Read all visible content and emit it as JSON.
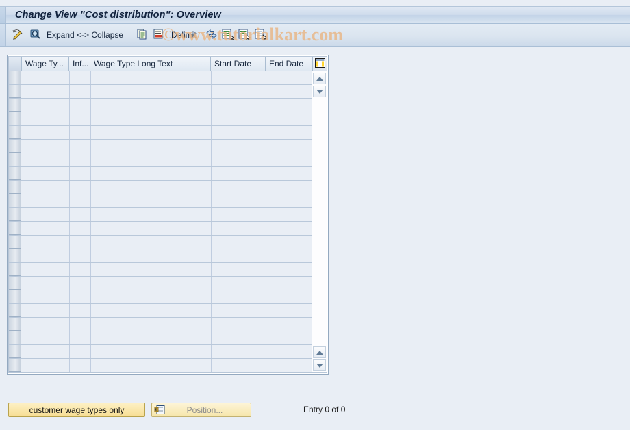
{
  "window": {
    "title": "Change View \"Cost distribution\": Overview"
  },
  "watermark": {
    "text": "©www.tutorialkart.com",
    "color": "#e8b98c"
  },
  "toolbar": {
    "items": [
      {
        "name": "display-change-icon",
        "icon": "pencil-glasses-icon",
        "label": ""
      },
      {
        "name": "check-entries-icon",
        "icon": "magnifier-check-icon",
        "label": ""
      },
      {
        "name": "expand-collapse-button",
        "icon": "",
        "label": "Expand <-> Collapse"
      },
      {
        "name": "copy-as-icon",
        "icon": "copy-icon",
        "label": ""
      },
      {
        "name": "undo-icon",
        "icon": "undo-page-icon",
        "label": ""
      },
      {
        "name": "delimit-button",
        "icon": "",
        "label": "Delimit"
      },
      {
        "name": "expand-all-icon",
        "icon": "expand-arrows-icon",
        "label": ""
      },
      {
        "name": "select-all-icon",
        "icon": "select-all-icon",
        "label": ""
      },
      {
        "name": "select-block-icon",
        "icon": "select-block-icon",
        "label": ""
      },
      {
        "name": "deselect-all-icon",
        "icon": "deselect-all-icon",
        "label": ""
      }
    ]
  },
  "table": {
    "columns": [
      {
        "key": "rowsel",
        "label": ""
      },
      {
        "key": "wage_type",
        "label": "Wage Ty..."
      },
      {
        "key": "infotype",
        "label": "Inf..."
      },
      {
        "key": "wage_type_long_text",
        "label": "Wage Type Long Text"
      },
      {
        "key": "start_date",
        "label": "Start Date"
      },
      {
        "key": "end_date",
        "label": "End Date"
      }
    ],
    "rows": [],
    "empty_row_count": 22,
    "config_icon": "table-settings-icon",
    "scroll": {
      "top_up_icon": "scroll-up-icon",
      "top_down_icon": "scroll-down-icon",
      "bottom_up_icon": "scroll-page-up-icon",
      "bottom_down_icon": "scroll-page-down-icon"
    }
  },
  "footer": {
    "customer_button_label": "customer wage types only",
    "position_button_label": "Position...",
    "position_icon": "position-find-icon",
    "entry_status": "Entry 0 of 0"
  }
}
